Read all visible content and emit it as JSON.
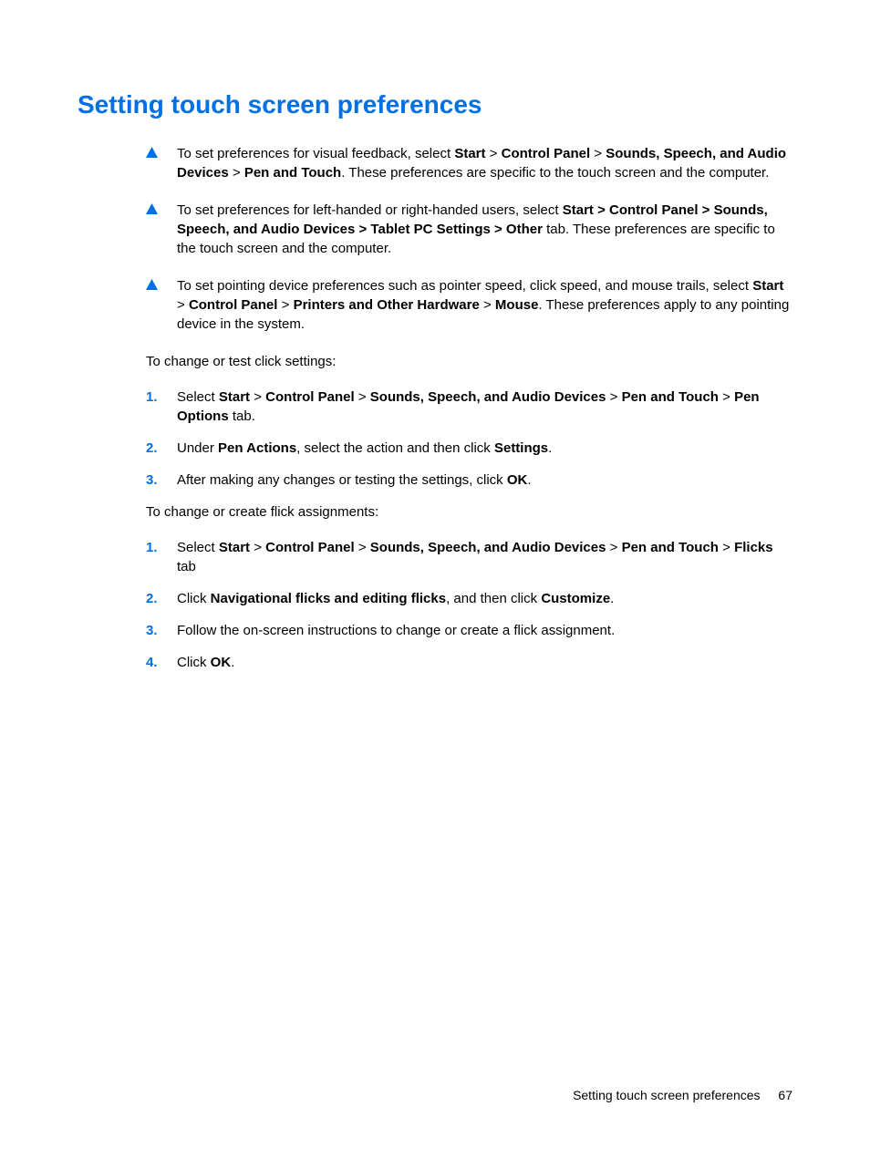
{
  "heading": "Setting touch screen preferences",
  "bullets": [
    {
      "html": "To set preferences for visual feedback, select <b>Start</b> > <b>Control Panel</b> > <b>Sounds, Speech, and Audio Devices</b> > <b>Pen and Touch</b>. These preferences are specific to the touch screen and the computer."
    },
    {
      "html": "To set preferences for left-handed or right-handed users, select <b>Start > Control Panel > Sounds, Speech, and Audio Devices > Tablet PC Settings  > Other</b> tab. These preferences are specific to the touch screen and the computer."
    },
    {
      "html": "To set pointing device preferences such as pointer speed, click speed, and mouse trails, select <b>Start</b> > <b>Control Panel</b> > <b>Printers and Other Hardware</b> > <b>Mouse</b>. These preferences apply to any pointing device in the system."
    }
  ],
  "section1_intro": "To change or test click settings:",
  "section1_steps": [
    {
      "num": "1.",
      "html": "Select <b>Start</b> > <b>Control Panel</b> > <b>Sounds, Speech, and Audio Devices</b> > <b>Pen and Touch</b> > <b>Pen Options</b> tab."
    },
    {
      "num": "2.",
      "html": "Under <b>Pen Actions</b>, select the action and then click <b>Settings</b>."
    },
    {
      "num": "3.",
      "html": "After making any changes or testing the settings, click <b>OK</b>."
    }
  ],
  "section2_intro": "To change or create flick assignments:",
  "section2_steps": [
    {
      "num": "1.",
      "html": "Select <b>Start</b> > <b>Control Panel</b> > <b>Sounds, Speech, and Audio Devices</b> > <b>Pen and Touch</b> > <b>Flicks</b> tab"
    },
    {
      "num": "2.",
      "html": "Click <b>Navigational flicks and editing flicks</b>, and then click <b>Customize</b>."
    },
    {
      "num": "3.",
      "html": "Follow the on-screen instructions to change or create a flick assignment."
    },
    {
      "num": "4.",
      "html": "Click <b>OK</b>."
    }
  ],
  "footer_label": "Setting touch screen preferences",
  "footer_page": "67"
}
